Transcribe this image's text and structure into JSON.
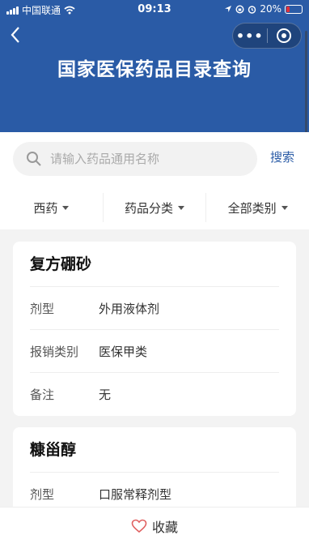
{
  "status_bar": {
    "carrier": "中国联通",
    "time": "09:13",
    "battery_text": "20%",
    "battery_level": 0.2
  },
  "header": {
    "title": "国家医保药品目录查询"
  },
  "search": {
    "placeholder": "请输入药品通用名称",
    "value": "",
    "button_label": "搜索"
  },
  "filters": [
    {
      "label": "西药"
    },
    {
      "label": "药品分类"
    },
    {
      "label": "全部类别"
    }
  ],
  "drugs": [
    {
      "name": "复方硼砂",
      "rows": [
        {
          "label": "剂型",
          "value": "外用液体剂"
        },
        {
          "label": "报销类别",
          "value": "医保甲类"
        },
        {
          "label": "备注",
          "value": "无"
        }
      ]
    },
    {
      "name": "糠甾醇",
      "rows": [
        {
          "label": "剂型",
          "value": "口服常释剂型"
        }
      ]
    }
  ],
  "bottom_bar": {
    "favorite_label": "收藏"
  },
  "colors": {
    "brand": "#2a5ba6",
    "battery_low": "#e0303a",
    "favorite_icon": "#e06060"
  }
}
